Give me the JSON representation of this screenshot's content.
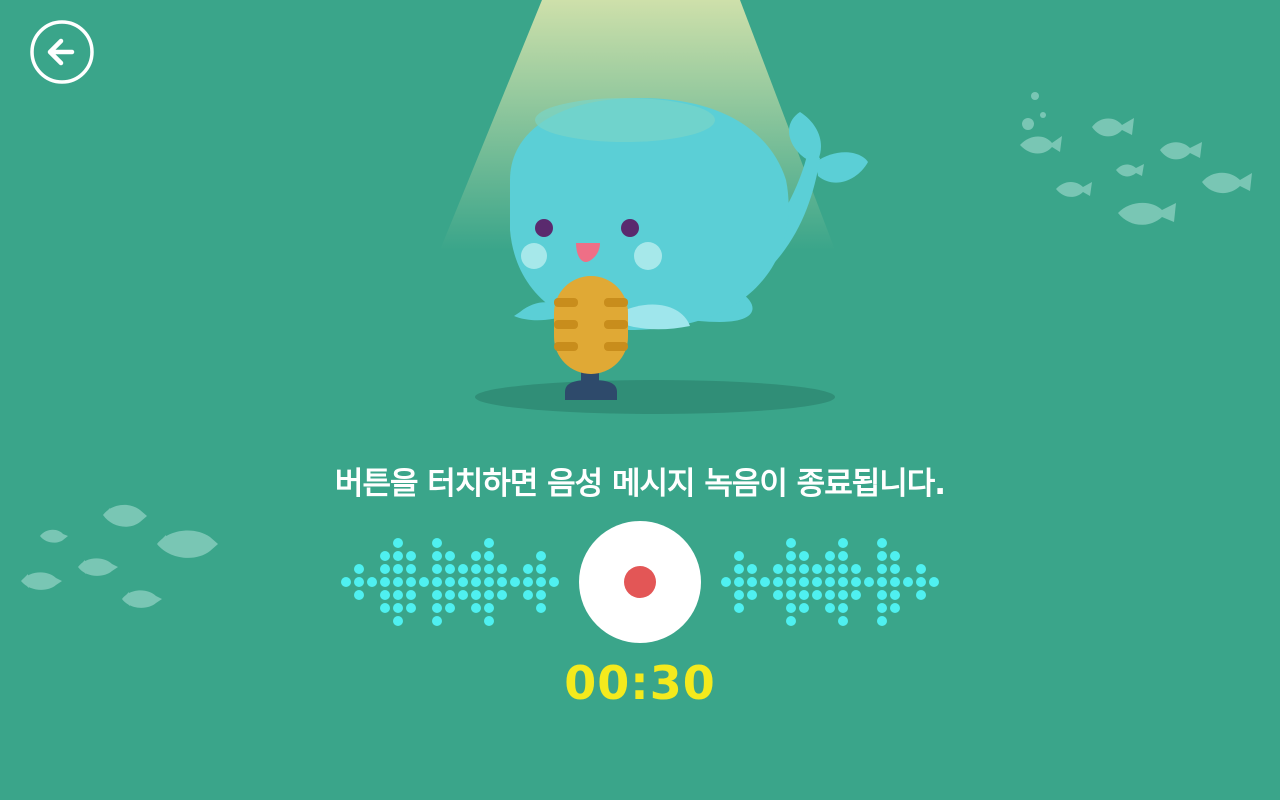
{
  "navigation": {
    "back_icon": "arrow-left-circle-icon"
  },
  "instruction_text": "버튼을 터치하면 음성 메시지 녹음이 종료됩니다.",
  "record_button": {
    "icon": "record-dot-icon",
    "state": "recording"
  },
  "timer": "00:30",
  "colors": {
    "background": "#3aa58a",
    "whale": "#5bcfd6",
    "microphone": "#e0a935",
    "record_dot": "#e35656",
    "timer": "#f4ea1d",
    "waveform": "#4ff0f0"
  },
  "waveform": {
    "left_columns": [
      1,
      3,
      1,
      5,
      7,
      5,
      1,
      7,
      5,
      3,
      5,
      7,
      3,
      1,
      3,
      5,
      1
    ],
    "right_columns": [
      1,
      5,
      3,
      1,
      3,
      7,
      5,
      3,
      5,
      7,
      3,
      1,
      7,
      5,
      1,
      3,
      1
    ]
  }
}
